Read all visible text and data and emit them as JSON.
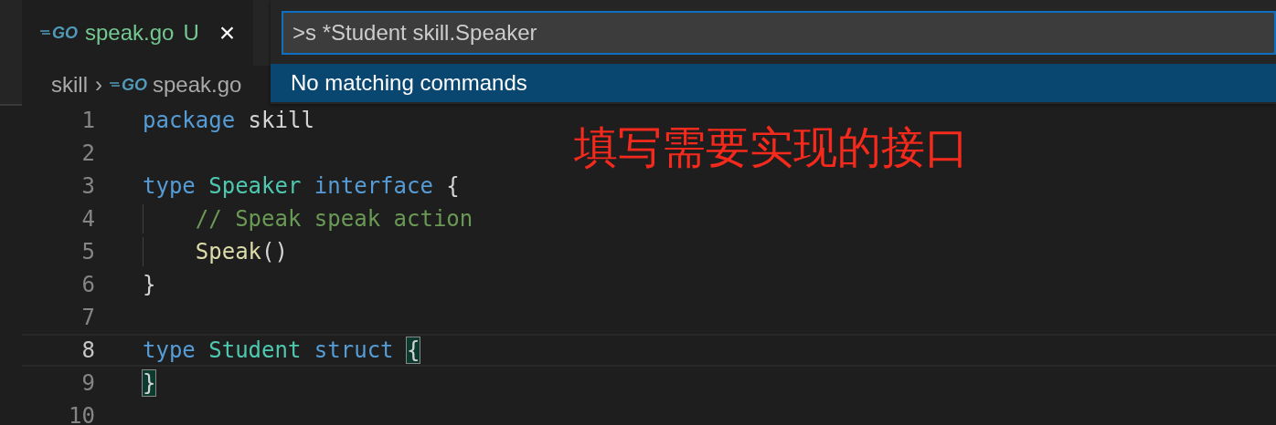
{
  "tab": {
    "icon_text": "GO",
    "label": "speak.go",
    "badge": "U",
    "close": "×",
    "selected": true
  },
  "breadcrumbs": [
    {
      "label": "skill"
    },
    {
      "label": "speak.go",
      "icon_text": "GO"
    }
  ],
  "separator": "›",
  "quick_input": {
    "value": ">s *Student skill.Speaker",
    "results": [
      {
        "label": "No matching commands",
        "selected": true
      }
    ]
  },
  "annotation": "填写需要实现的接口",
  "code": [
    {
      "number": "1",
      "current": false,
      "indent_guide": false,
      "tokens": [
        {
          "text": "package",
          "kind": "keyword"
        },
        {
          "text": " skill",
          "kind": "plain"
        }
      ]
    },
    {
      "number": "2",
      "current": false,
      "indent_guide": false
    },
    {
      "number": "3",
      "current": false,
      "indent_guide": false,
      "tokens": [
        {
          "text": "type",
          "kind": "keyword"
        },
        {
          "text": " Speaker",
          "kind": "type"
        },
        {
          "text": " interface",
          "kind": "keyword"
        },
        {
          "text": " {",
          "kind": "plain"
        }
      ]
    },
    {
      "number": "4",
      "current": false,
      "indent_guide": true,
      "tokens": [
        {
          "text": "    // Speak speak action",
          "kind": "comment"
        }
      ]
    },
    {
      "number": "5",
      "current": false,
      "indent_guide": true,
      "tokens": [
        {
          "text": "    Speak",
          "kind": "function"
        },
        {
          "text": "()",
          "kind": "plain"
        }
      ]
    },
    {
      "number": "6",
      "current": false,
      "indent_guide": false,
      "tokens": [
        {
          "text": "}",
          "kind": "plain"
        }
      ]
    },
    {
      "number": "7",
      "current": false,
      "indent_guide": false
    },
    {
      "number": "8",
      "current": true,
      "indent_guide": false,
      "tokens": [
        {
          "text": "type",
          "kind": "keyword"
        },
        {
          "text": " Student",
          "kind": "type"
        },
        {
          "text": " struct",
          "kind": "keyword"
        },
        {
          "text": " {",
          "kind": "bracket-match"
        }
      ]
    },
    {
      "number": "9",
      "current": false,
      "indent_guide": false,
      "tokens": [
        {
          "text": "}",
          "kind": "bracket-match"
        }
      ]
    },
    {
      "number": "10",
      "current": false,
      "indent_guide": false
    }
  ]
}
